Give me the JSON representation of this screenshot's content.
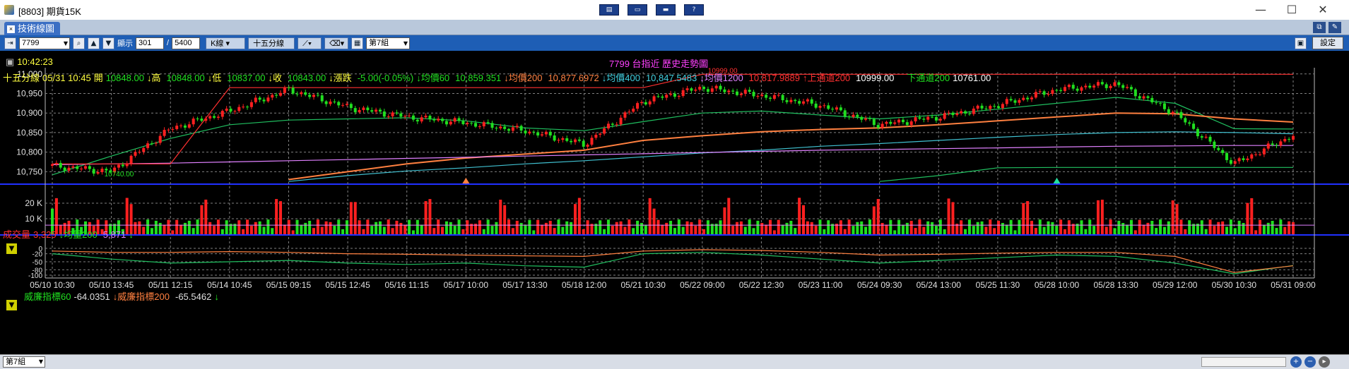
{
  "window": {
    "title": "[8803] 期貨15K",
    "toolbar_icons": [
      "layout-icon",
      "window-icon",
      "minimize-panel-icon",
      "help-icon"
    ],
    "min_label": "—",
    "max_label": "☐",
    "close_label": "✕"
  },
  "tab": {
    "close_label": "×",
    "label": "技術線圖"
  },
  "toolbar": {
    "symbol_value": "7799",
    "display_label": "顯示",
    "display_count": "301",
    "slash": "/",
    "display_total": "5400",
    "kline_label": "K線",
    "period_label": "十五分線",
    "group_label": "第7組",
    "settings_label": "設定"
  },
  "header": {
    "time": "10:42:23",
    "center_title": "7799 台指近   歷史走勢圖"
  },
  "quote": {
    "period": "十五分線",
    "datetime": "05/31 10:45",
    "open_label": "開",
    "open": "10848.00",
    "high_label": "高",
    "high": "10848.00",
    "low_label": "低",
    "low": "10837.00",
    "close_label": "收",
    "close": "10843.00",
    "change_label": "漲跌",
    "change": "-5.00(-0.05%)",
    "ma60_label": "均價60",
    "ma60": "10,859.351",
    "ma200_label": "均價200",
    "ma200": "10,877.6972",
    "ma400_label": "均價400",
    "ma400": "10,847.5483",
    "ma1200_label": "均價1200",
    "ma1200": "10,817.9889",
    "upper_label": "上通道200",
    "upper": "10999.00",
    "lower_label": "下通道200",
    "lower": "10761.00"
  },
  "volume": {
    "label": "成交量",
    "value": "3,325",
    "avg_label": "均量200",
    "avg_value": "5,871"
  },
  "williams": {
    "label60": "威廉指標60",
    "value60": "-64.0351",
    "label200": "威廉指標200",
    "value200": "-65.5462"
  },
  "status": {
    "group": "第7組"
  },
  "colors": {
    "up": "#ff2020",
    "down": "#20e020",
    "ma60": "#20c060",
    "ma200": "#ff8040",
    "ma400": "#40c0d0",
    "ma1200": "#e080ff",
    "upper": "#ff3030",
    "grid": "#808080"
  },
  "chart_data": [
    {
      "type": "line",
      "title": "7799 台指近   歷史走勢圖",
      "ylim": [
        10720,
        11005
      ],
      "yticks": [
        "11,000",
        "10,950",
        "10,900",
        "10,850",
        "10,800",
        "10,750"
      ],
      "ytick_values": [
        11000,
        10950,
        10900,
        10850,
        10800,
        10750
      ],
      "xticks": [
        "05/10 10:30",
        "05/10 13:45",
        "05/11 12:15",
        "05/14 10:45",
        "05/15 09:15",
        "05/15 12:45",
        "05/16 11:15",
        "05/17 10:00",
        "05/17 13:30",
        "05/18 12:00",
        "05/21 10:30",
        "05/22 09:00",
        "05/22 12:30",
        "05/23 11:00",
        "05/24 09:30",
        "05/24 13:00",
        "05/25 11:30",
        "05/28 10:00",
        "05/28 13:30",
        "05/29 12:00",
        "05/30 10:30",
        "05/31 09:00"
      ],
      "annotations": [
        "10999.00",
        "10740.00"
      ],
      "series": [
        {
          "name": "均價60",
          "values": [
            10742,
            10790,
            10835,
            10870,
            10882,
            10885,
            10888,
            10880,
            10862,
            10855,
            10878,
            10900,
            10905,
            10895,
            10885,
            10895,
            10910,
            10925,
            10940,
            10925,
            10860,
            10859
          ]
        },
        {
          "name": "均價200",
          "values": [
            null,
            null,
            null,
            null,
            10730,
            10750,
            10770,
            10785,
            10795,
            10805,
            10830,
            10842,
            10852,
            10858,
            10862,
            10870,
            10880,
            10890,
            10900,
            10898,
            10885,
            10877
          ]
        },
        {
          "name": "均價400",
          "values": [
            null,
            null,
            null,
            null,
            10725,
            10740,
            10752,
            10760,
            10770,
            10778,
            10788,
            10798,
            10805,
            10815,
            10822,
            10830,
            10838,
            10845,
            10850,
            10852,
            10850,
            10847
          ]
        },
        {
          "name": "均價1200",
          "values": [
            10768,
            10770,
            10772,
            10775,
            10778,
            10781,
            10784,
            10787,
            10790,
            10793,
            10796,
            10799,
            10802,
            10805,
            10807,
            10809,
            10811,
            10813,
            10815,
            10816,
            10817,
            10817
          ]
        },
        {
          "name": "上通道200",
          "values": [
            10770,
            10770,
            10770,
            10965,
            10965,
            10965,
            10965,
            10965,
            10965,
            10965,
            10965,
            10999,
            10999,
            10999,
            10999,
            10999,
            10999,
            10999,
            10999,
            10999,
            10999,
            10999
          ]
        },
        {
          "name": "下通道200",
          "values": [
            null,
            null,
            null,
            null,
            null,
            null,
            null,
            null,
            null,
            null,
            null,
            null,
            null,
            null,
            10725,
            10740,
            10760,
            10761,
            10761,
            10761,
            10761,
            10761
          ]
        },
        {
          "name": "收",
          "values": [
            10765,
            10750,
            10860,
            10905,
            10960,
            10915,
            10890,
            10875,
            10855,
            10820,
            10930,
            10965,
            10945,
            10920,
            10870,
            10890,
            10920,
            10960,
            10975,
            10900,
            10770,
            10843
          ]
        }
      ]
    },
    {
      "type": "bar",
      "title": "成交量",
      "ylim": [
        0,
        25000
      ],
      "yticks": [
        "20 K",
        "10 K"
      ],
      "ytick_values": [
        20000,
        10000
      ],
      "series": [
        {
          "name": "均量200",
          "values": [
            5871
          ]
        }
      ]
    },
    {
      "type": "line",
      "title": "威廉指標",
      "ylim": [
        -100,
        0
      ],
      "yticks": [
        "0",
        "-20",
        "-50",
        "-80",
        "-100"
      ],
      "ytick_values": [
        0,
        -20,
        -50,
        -80,
        -100
      ],
      "series": [
        {
          "name": "威廉指標60",
          "values": [
            -20,
            -40,
            -55,
            -50,
            -45,
            -55,
            -60,
            -55,
            -65,
            -70,
            -20,
            -15,
            -25,
            -40,
            -55,
            -45,
            -35,
            -25,
            -30,
            -55,
            -95,
            -64
          ]
        },
        {
          "name": "威廉指標200",
          "values": [
            -10,
            -15,
            -15,
            -12,
            -15,
            -20,
            -22,
            -25,
            -28,
            -30,
            -10,
            -5,
            -8,
            -15,
            -25,
            -22,
            -18,
            -15,
            -15,
            -30,
            -90,
            -65
          ]
        }
      ]
    }
  ]
}
